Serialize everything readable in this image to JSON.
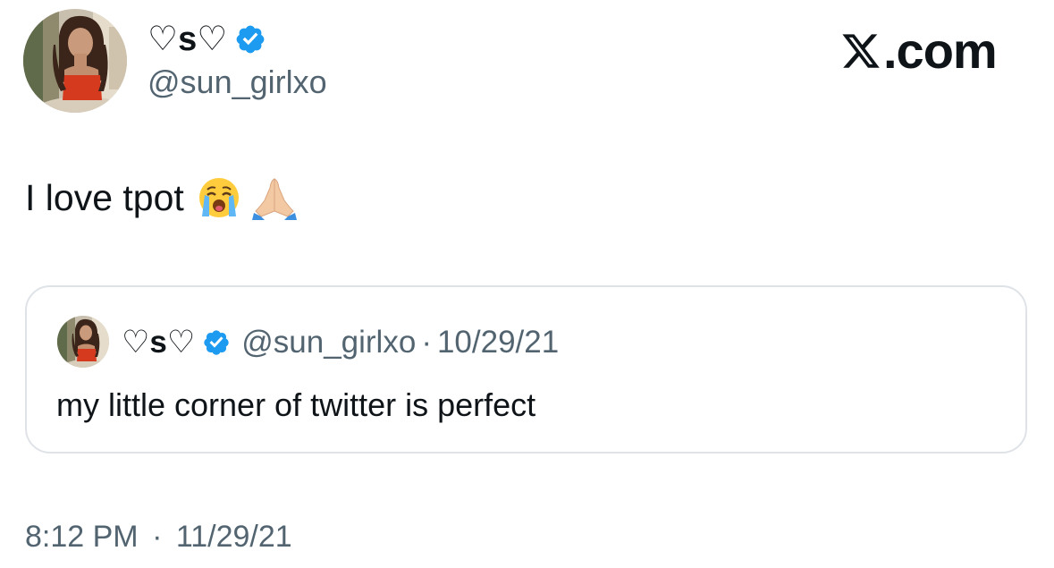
{
  "tweet": {
    "display_name": "♡s♡",
    "handle": "@sun_girlxo",
    "verified": true,
    "text": "I love tpot",
    "emojis": [
      "loudly-crying-face-emoji",
      "folded-hands-emoji"
    ],
    "time": "8:12 PM",
    "separator": "·",
    "date": "11/29/21"
  },
  "brand": {
    "text": ".com",
    "icon": "x-logo-icon"
  },
  "quoted_tweet": {
    "display_name": "♡s♡",
    "handle": "@sun_girlxo",
    "separator": "·",
    "date": "10/29/21",
    "verified": true,
    "text": "my little corner of twitter is perfect"
  },
  "colors": {
    "text_primary": "#0f1419",
    "text_secondary": "#536471",
    "verified_blue": "#1d9bf0",
    "card_border": "#dfe3e7",
    "background": "#ffffff"
  }
}
